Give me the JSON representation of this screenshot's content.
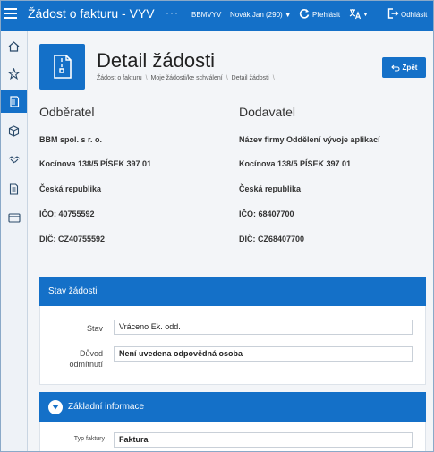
{
  "header": {
    "app_title": "Žádost o fakturu - VYV",
    "more": "···",
    "code": "BBMVYV",
    "user": "Novák Jan (290)",
    "login_label": "Přehlásit",
    "logout_label": "Odhlásit",
    "bg_color": "#1470c8"
  },
  "sidebar": {
    "items": [
      {
        "icon": "home-icon"
      },
      {
        "icon": "star-icon"
      },
      {
        "icon": "invoice-icon",
        "active": true
      },
      {
        "icon": "box-icon"
      },
      {
        "icon": "handshake-icon"
      },
      {
        "icon": "document-icon"
      },
      {
        "icon": "card-icon"
      }
    ]
  },
  "page": {
    "title": "Detail žádosti",
    "breadcrumb": [
      "Žádost o fakturu",
      "Moje žádosti/ke schválení",
      "Detail žádosti"
    ],
    "back_label": "Zpět"
  },
  "buyer": {
    "heading": "Odběratel",
    "name": "BBM spol. s r. o.",
    "address": "Kocínova 138/5 PÍSEK 397 01",
    "country": "Česká republika",
    "ico": "IČO: 40755592",
    "dic": "DIČ: CZ40755592"
  },
  "supplier": {
    "heading": "Dodavatel",
    "name": "Název firmy Oddělení vývoje aplikací",
    "address": "Kocínova 138/5 PÍSEK 397 01",
    "country": "Česká republika",
    "ico": "IČO: 68407700",
    "dic": "DIČ: CZ68407700"
  },
  "status_panel": {
    "title": "Stav žádosti",
    "state_label": "Stav",
    "state_value": "Vráceno Ek. odd.",
    "reason_label_1": "Důvod",
    "reason_label_2": "odmítnutí",
    "reason_value": "Není uvedena odpovědná osoba"
  },
  "basic_panel": {
    "title": "Základní informace",
    "type_label": "Typ faktury",
    "type_value": "Faktura"
  }
}
